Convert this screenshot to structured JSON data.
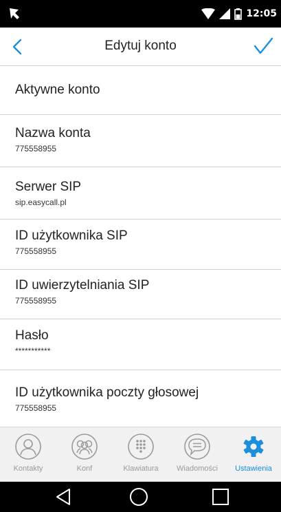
{
  "status_bar": {
    "time": "12:05"
  },
  "header": {
    "title": "Edytuj konto"
  },
  "settings": [
    {
      "title": "Aktywne konto",
      "value": ""
    },
    {
      "title": "Nazwa konta",
      "value": "775558955"
    },
    {
      "title": "Serwer SIP",
      "value": "sip.easycall.pl"
    },
    {
      "title": "ID użytkownika SIP",
      "value": "775558955"
    },
    {
      "title": "ID uwierzytelniania SIP",
      "value": "775558955"
    },
    {
      "title": "Hasło",
      "value": "***********"
    },
    {
      "title": "ID użytkownika poczty głosowej",
      "value": "775558955"
    }
  ],
  "bottom_nav": [
    {
      "label": "Kontakty",
      "icon": "contacts-icon",
      "active": false
    },
    {
      "label": "Konf",
      "icon": "conference-icon",
      "active": false
    },
    {
      "label": "Klawiatura",
      "icon": "keypad-icon",
      "active": false
    },
    {
      "label": "Wiadomości",
      "icon": "messages-icon",
      "active": false
    },
    {
      "label": "Ustawienia",
      "icon": "settings-gear-icon",
      "active": true
    }
  ],
  "colors": {
    "accent": "#1a8fdc",
    "inactive": "#9a9a9a",
    "nav_bg": "#f1f1f1",
    "divider": "#cfcfcf"
  }
}
